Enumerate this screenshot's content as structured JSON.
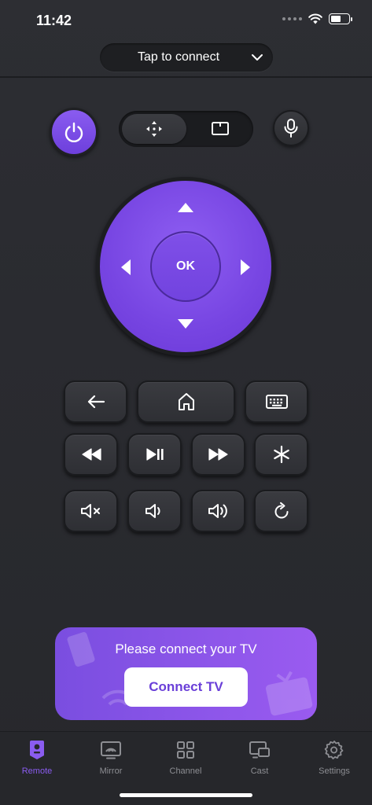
{
  "status_bar": {
    "time": "11:42"
  },
  "header": {
    "connect_label": "Tap to connect"
  },
  "remote": {
    "ok_label": "OK"
  },
  "connect_card": {
    "title": "Please connect your TV",
    "button_label": "Connect TV"
  },
  "tabs": [
    {
      "label": "Remote",
      "icon": "remote-icon",
      "active": true
    },
    {
      "label": "Mirror",
      "icon": "mirror-icon",
      "active": false
    },
    {
      "label": "Channel",
      "icon": "channel-grid-icon",
      "active": false
    },
    {
      "label": "Cast",
      "icon": "cast-icon",
      "active": false
    },
    {
      "label": "Settings",
      "icon": "gear-icon",
      "active": false
    }
  ],
  "colors": {
    "accent": "#7a4ee0",
    "background": "#2a2b2f",
    "tab_inactive": "#8d8e93"
  }
}
